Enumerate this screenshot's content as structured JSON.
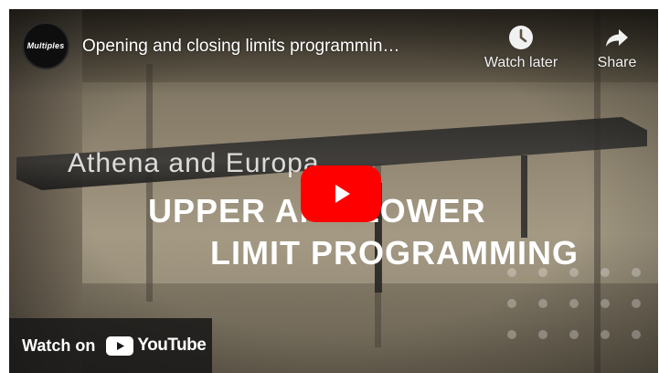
{
  "header": {
    "channel_avatar_text": "Multiples",
    "video_title": "Opening and closing limits programmin…",
    "watch_later_label": "Watch later",
    "share_label": "Share"
  },
  "video": {
    "subtitle": "Athena and Europa",
    "headline_line1": "UPPER AND LOWER",
    "headline_line2": "LIMIT PROGRAMMING"
  },
  "footer": {
    "watch_on_label": "Watch on",
    "youtube_label": "YouTube"
  },
  "colors": {
    "play_button": "#ff0000",
    "text": "#ffffff",
    "overlay_bar": "#171717"
  },
  "icons": {
    "watch_later": "clock-icon",
    "share": "share-arrow-icon",
    "play": "play-icon",
    "youtube": "youtube-logo-icon"
  }
}
